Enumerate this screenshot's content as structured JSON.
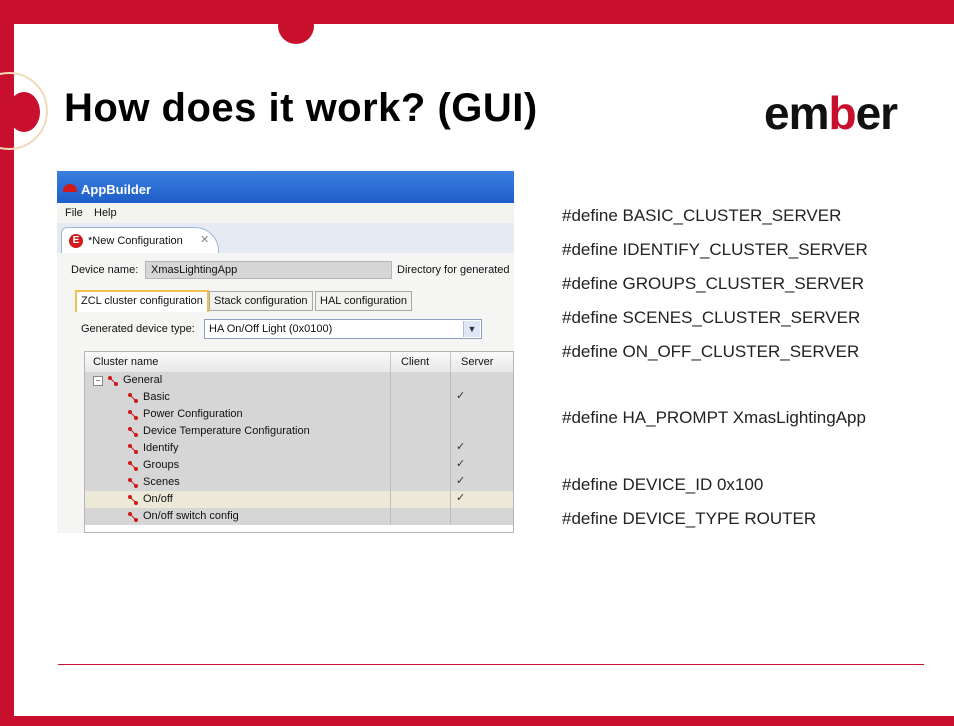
{
  "slide": {
    "title": "How does it work? (GUI)",
    "logo": {
      "pre": "em",
      "accent": "b",
      "post": "er"
    },
    "colors": {
      "frame": "#c8102e",
      "titlebar": "#1e5fc8"
    }
  },
  "app": {
    "title": "AppBuilder",
    "menu": [
      "File",
      "Help"
    ],
    "tab": {
      "label": "*New Configuration",
      "icon": "E",
      "close": "✕"
    },
    "device_name_label": "Device name:",
    "device_name_value": "XmasLightingApp",
    "directory_label": "Directory for generated",
    "config_tabs": [
      "ZCL cluster configuration",
      "Stack configuration",
      "HAL configuration"
    ],
    "device_type_label": "Generated device type:",
    "device_type_value": "HA On/Off Light (0x0100)",
    "tree": {
      "headers": {
        "name": "Cluster name",
        "client": "Client",
        "server": "Server"
      },
      "group": {
        "expander": "−",
        "label": "General"
      },
      "check_mark": "✓",
      "rows": [
        {
          "label": "Basic",
          "server": true
        },
        {
          "label": "Power Configuration",
          "server": false
        },
        {
          "label": "Device Temperature Configuration",
          "server": false
        },
        {
          "label": "Identify",
          "server": true
        },
        {
          "label": "Groups",
          "server": true
        },
        {
          "label": "Scenes",
          "server": true
        },
        {
          "label": "On/off",
          "server": true
        },
        {
          "label": "On/off switch config",
          "server": false
        }
      ]
    }
  },
  "code_lines": [
    "#define BASIC_CLUSTER_SERVER",
    "#define IDENTIFY_CLUSTER_SERVER",
    "#define GROUPS_CLUSTER_SERVER",
    "#define SCENES_CLUSTER_SERVER",
    "#define ON_OFF_CLUSTER_SERVER",
    "#define HA_PROMPT XmasLightingApp",
    "#define DEVICE_ID 0x100",
    "#define DEVICE_TYPE ROUTER"
  ]
}
